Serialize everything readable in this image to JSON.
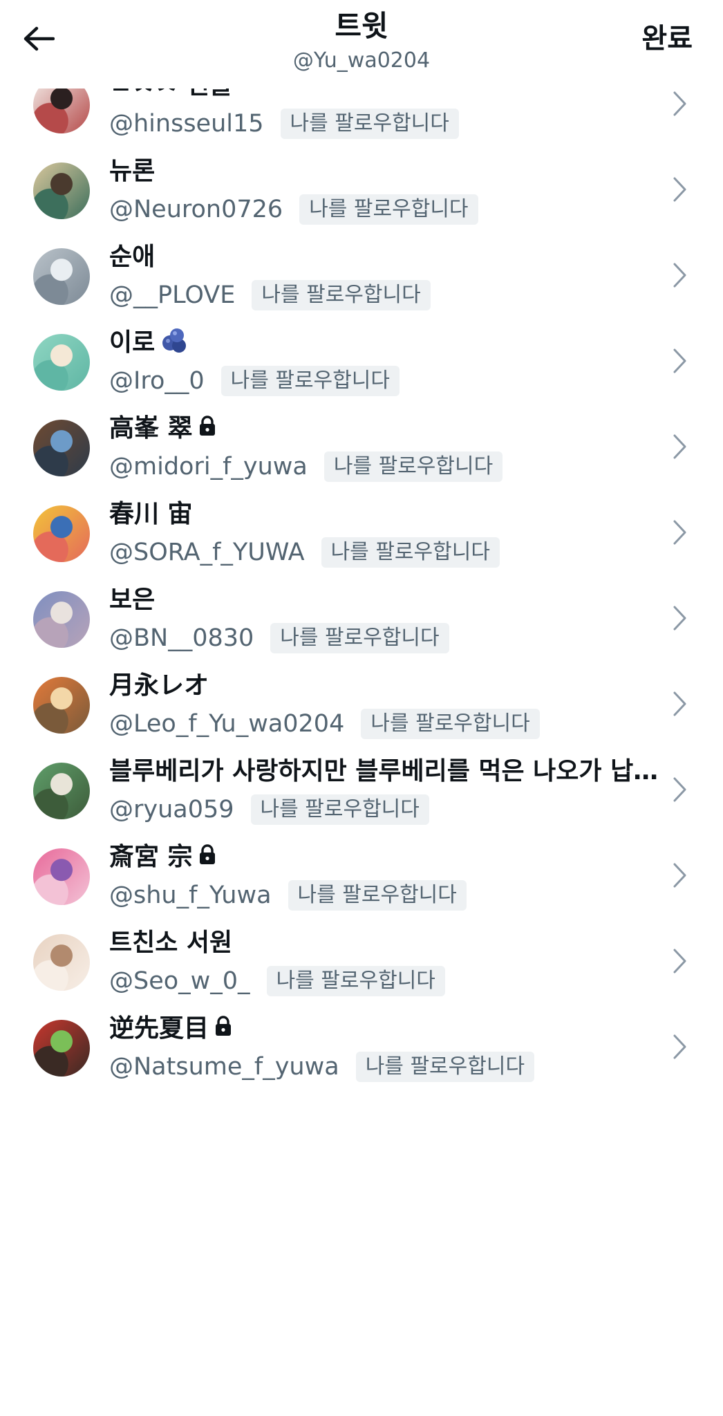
{
  "header": {
    "title": "트윗",
    "subtitle": "@Yu_wa0204",
    "done_label": "완료"
  },
  "badge_label": "나를 팔로우합니다",
  "users": [
    {
      "name": "ㅌㅊㅅ 힌쓸",
      "handle": "@hinsseul15",
      "extra": "",
      "avatar_colors": [
        "#f3ece8",
        "#2b2020",
        "#b54a4a"
      ]
    },
    {
      "name": "뉴론",
      "handle": "@Neuron0726",
      "extra": "",
      "avatar_colors": [
        "#d9c79c",
        "#4a3a2e",
        "#3d6f5c"
      ]
    },
    {
      "name": "순애",
      "handle": "@__PLOVE",
      "extra": "",
      "avatar_colors": [
        "#b9c2c9",
        "#e9eef2",
        "#7d8a96"
      ]
    },
    {
      "name": "이로",
      "handle": "@Iro__0",
      "extra": "blueberry",
      "avatar_colors": [
        "#8fd6c2",
        "#f4e8d6",
        "#5fb6a4"
      ]
    },
    {
      "name": "高峯 翠",
      "handle": "@midori_f_yuwa",
      "extra": "lock",
      "avatar_colors": [
        "#6e4a32",
        "#6d9bc8",
        "#2e3b4a"
      ]
    },
    {
      "name": "春川 宙",
      "handle": "@SORA_f_YUWA",
      "extra": "",
      "avatar_colors": [
        "#f2c33a",
        "#3b6fb6",
        "#e46a5a"
      ]
    },
    {
      "name": "보은",
      "handle": "@BN__0830",
      "extra": "",
      "avatar_colors": [
        "#7f8fc0",
        "#e9e2de",
        "#b7a3b9"
      ]
    },
    {
      "name": "月永レオ",
      "handle": "@Leo_f_Yu_wa0204",
      "extra": "",
      "avatar_colors": [
        "#e27a3a",
        "#f3d7a8",
        "#7a5a3a"
      ]
    },
    {
      "name": "블루베리가 사랑하지만 블루베리를 먹은 나오가 납…",
      "handle": "@ryua059",
      "extra": "",
      "avatar_colors": [
        "#5f9e6a",
        "#e8e4d8",
        "#3d5c3a"
      ]
    },
    {
      "name": "斎宮 宗",
      "handle": "@shu_f_Yuwa",
      "extra": "lock",
      "avatar_colors": [
        "#e86a9a",
        "#8a5ab0",
        "#f3c2d6"
      ]
    },
    {
      "name": "트친소 서원",
      "handle": "@Seo_w_0_",
      "extra": "",
      "avatar_colors": [
        "#e8d3c2",
        "#b28a6e",
        "#f7eee6"
      ]
    },
    {
      "name": "逆先夏目",
      "handle": "@Natsume_f_yuwa",
      "extra": "lock",
      "avatar_colors": [
        "#c7372e",
        "#7bbf58",
        "#3a2a24"
      ]
    }
  ],
  "colors": {
    "text_primary": "#0f1419",
    "text_secondary": "#536471",
    "badge_bg": "#eef1f3",
    "chevron": "#8b98a5"
  },
  "icons": {
    "back": "arrow-left-icon",
    "chevron": "chevron-right-icon",
    "lock": "lock-icon",
    "blueberry": "blueberry-icon"
  }
}
